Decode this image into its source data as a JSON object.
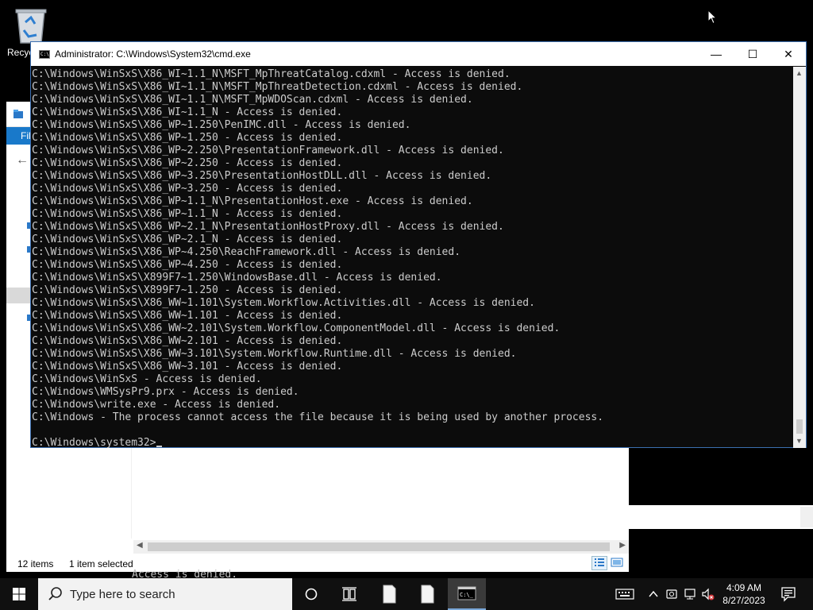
{
  "desktop": {
    "recycle_bin_label": "Recyc"
  },
  "explorer": {
    "file_tab": "Fil",
    "status_items": "12 items",
    "status_selected": "1 item selected"
  },
  "background_text": "Access is denied.",
  "cmd": {
    "title": "Administrator: C:\\Windows\\System32\\cmd.exe",
    "lines": [
      "C:\\Windows\\WinSxS\\X86_WI~1.1_N\\MSFT_MpThreatCatalog.cdxml - Access is denied.",
      "C:\\Windows\\WinSxS\\X86_WI~1.1_N\\MSFT_MpThreatDetection.cdxml - Access is denied.",
      "C:\\Windows\\WinSxS\\X86_WI~1.1_N\\MSFT_MpWDOScan.cdxml - Access is denied.",
      "C:\\Windows\\WinSxS\\X86_WI~1.1_N - Access is denied.",
      "C:\\Windows\\WinSxS\\X86_WP~1.250\\PenIMC.dll - Access is denied.",
      "C:\\Windows\\WinSxS\\X86_WP~1.250 - Access is denied.",
      "C:\\Windows\\WinSxS\\X86_WP~2.250\\PresentationFramework.dll - Access is denied.",
      "C:\\Windows\\WinSxS\\X86_WP~2.250 - Access is denied.",
      "C:\\Windows\\WinSxS\\X86_WP~3.250\\PresentationHostDLL.dll - Access is denied.",
      "C:\\Windows\\WinSxS\\X86_WP~3.250 - Access is denied.",
      "C:\\Windows\\WinSxS\\X86_WP~1.1_N\\PresentationHost.exe - Access is denied.",
      "C:\\Windows\\WinSxS\\X86_WP~1.1_N - Access is denied.",
      "C:\\Windows\\WinSxS\\X86_WP~2.1_N\\PresentationHostProxy.dll - Access is denied.",
      "C:\\Windows\\WinSxS\\X86_WP~2.1_N - Access is denied.",
      "C:\\Windows\\WinSxS\\X86_WP~4.250\\ReachFramework.dll - Access is denied.",
      "C:\\Windows\\WinSxS\\X86_WP~4.250 - Access is denied.",
      "C:\\Windows\\WinSxS\\X899F7~1.250\\WindowsBase.dll - Access is denied.",
      "C:\\Windows\\WinSxS\\X899F7~1.250 - Access is denied.",
      "C:\\Windows\\WinSxS\\X86_WW~1.101\\System.Workflow.Activities.dll - Access is denied.",
      "C:\\Windows\\WinSxS\\X86_WW~1.101 - Access is denied.",
      "C:\\Windows\\WinSxS\\X86_WW~2.101\\System.Workflow.ComponentModel.dll - Access is denied.",
      "C:\\Windows\\WinSxS\\X86_WW~2.101 - Access is denied.",
      "C:\\Windows\\WinSxS\\X86_WW~3.101\\System.Workflow.Runtime.dll - Access is denied.",
      "C:\\Windows\\WinSxS\\X86_WW~3.101 - Access is denied.",
      "C:\\Windows\\WinSxS - Access is denied.",
      "C:\\Windows\\WMSysPr9.prx - Access is denied.",
      "C:\\Windows\\write.exe - Access is denied.",
      "C:\\Windows - The process cannot access the file because it is being used by another process.",
      "",
      "C:\\Windows\\system32>"
    ],
    "controls": {
      "minimize": "—",
      "maximize": "☐",
      "close": "✕"
    }
  },
  "taskbar": {
    "search_placeholder": "Type here to search",
    "time": "4:09 AM",
    "date": "8/27/2023"
  },
  "colors": {
    "console_bg": "#0c0c0c",
    "console_fg": "#cccccc",
    "taskbar_bg": "#101010",
    "accent": "#1979ca"
  }
}
